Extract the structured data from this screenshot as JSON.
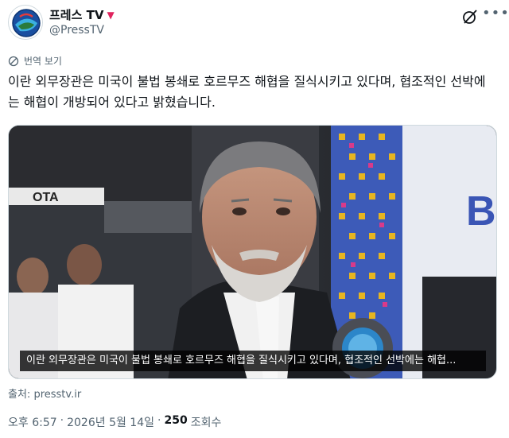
{
  "account": {
    "display_name": "프레스 TV",
    "verified_glyph": "▼",
    "handle": "@PressTV",
    "avatar_icon": "presstv-logo-icon"
  },
  "actions": {
    "grok_icon": "grok-icon",
    "more_icon": "more-icon"
  },
  "translate": {
    "label": "번역 보기",
    "icon": "globe-icon"
  },
  "tweet": {
    "text": "이란 외무장관은 미국이 불법 봉쇄로 호르무즈 해협을 질식시키고 있다며, 협조적인 선박에는 해협이 개방되어 있다고 밝혔습니다."
  },
  "media": {
    "subtitle": "이란 외무장관은 미국이 불법 봉쇄로 호르무즈 해협을 질식시키고 있다며, 협조적인 선박에는 해협...",
    "banner_letter": "B",
    "sign_text": "OTA"
  },
  "source": {
    "prefix": "출처: ",
    "link": "presstv.ir"
  },
  "meta": {
    "time": "오후 6:57",
    "sep1": "·",
    "date": "2026년 5월 14일",
    "sep2": "·",
    "views": "250",
    "views_label": "조회수"
  }
}
